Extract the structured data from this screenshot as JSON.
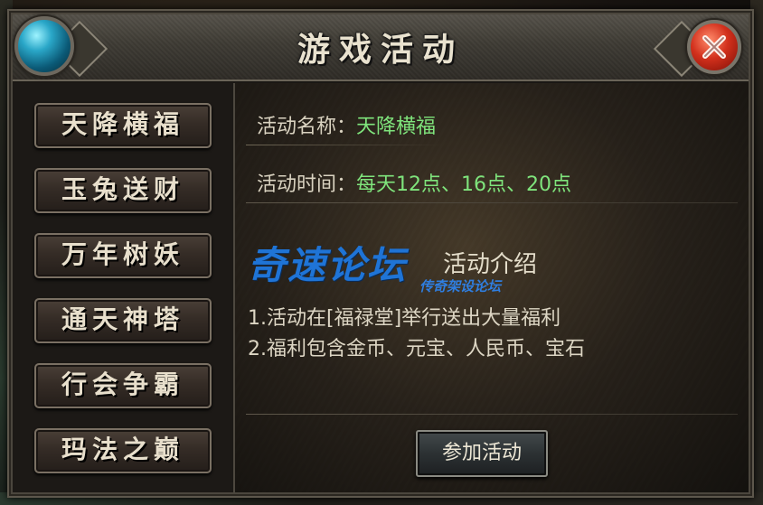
{
  "window": {
    "title": "游戏活动"
  },
  "icons": {
    "orb": "blue-orb-icon",
    "close": "close-icon"
  },
  "colors": {
    "highlight_value": "#7fe47c",
    "watermark": "#1f74d6",
    "close_red": "#d2301c",
    "orb_blue": "#2aa7c8"
  },
  "menu": {
    "items": [
      {
        "label": "天降横福"
      },
      {
        "label": "玉兔送财"
      },
      {
        "label": "万年树妖"
      },
      {
        "label": "通天神塔"
      },
      {
        "label": "行会争霸"
      },
      {
        "label": "玛法之巅"
      }
    ]
  },
  "activity": {
    "name_label": "活动名称：",
    "name_value": "天降横福",
    "time_label": "活动时间：",
    "time_value": "每天12点、16点、20点",
    "section_title": "活动介绍",
    "description": [
      "1.活动在[福禄堂]举行送出大量福利",
      "2.福利包含金币、元宝、人民币、宝石"
    ],
    "join_label": "参加活动"
  },
  "watermark": {
    "main": "奇速论坛",
    "sub": "传奇架设论坛"
  }
}
